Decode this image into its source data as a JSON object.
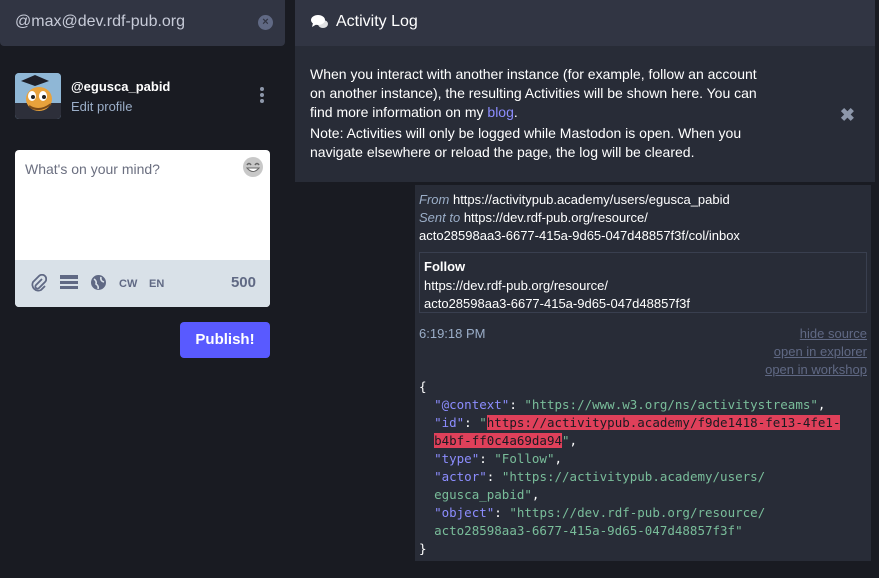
{
  "search": {
    "value": "@max@dev.rdf-pub.org"
  },
  "account": {
    "handle": "@egusca_pabid",
    "edit_label": "Edit profile"
  },
  "compose": {
    "placeholder": "What's on your mind?",
    "cw_label": "CW",
    "lang_label": "EN",
    "char_count": "500",
    "publish_label": "Publish!"
  },
  "column": {
    "title": "Activity Log",
    "notice_p1_before": "When you interact with another instance (for example, follow an account on another instance), the resulting Activities will be shown here. You can find more information on my ",
    "notice_link": "blog",
    "notice_p1_after": ".",
    "notice_p2": "Note: Activities will only be logged while Mastodon is open. When you navigate elsewhere or reload the page, the log will be cleared."
  },
  "entry": {
    "from_label": "From",
    "from_value": "https://activitypub.academy/users/egusca_pabid",
    "sent_label": "Sent to",
    "sent_value_1": "https://dev.rdf-pub.org/resource/",
    "sent_value_2": "acto28598aa3-6677-415a-9d65-047d48857f3f/col/inbox",
    "type_label": "Follow",
    "object_1": "https://dev.rdf-pub.org/resource/",
    "object_2": "acto28598aa3-6677-415a-9d65-047d48857f3f",
    "time": "6:19:18 PM",
    "hide_source": "hide source",
    "open_explorer": "open in explorer",
    "open_workshop": "open in workshop"
  },
  "json": {
    "context_key": "\"@context\"",
    "context_val": "\"https://www.w3.org/ns/activitystreams\"",
    "id_key": "\"id\"",
    "id_val_1": "https://activitypub.academy/f9de1418-fe13-4fe1-",
    "id_val_2": "b4bf-ff0c4a69da94",
    "type_key": "\"type\"",
    "type_val": "\"Follow\"",
    "actor_key": "\"actor\"",
    "actor_val_1": "\"https://activitypub.academy/users/",
    "actor_val_2": "egusca_pabid\"",
    "object_key": "\"object\"",
    "object_val_1": "\"https://dev.rdf-pub.org/resource/",
    "object_val_2": "acto28598aa3-6677-415a-9d65-047d48857f3f\""
  },
  "colors": {
    "accent": "#595aff",
    "link": "#8c8dff",
    "string": "#79bd9a",
    "highlight": "#df405a"
  },
  "icons": [
    "search-clear-icon",
    "kebab-menu-icon",
    "emoji-icon",
    "paperclip-icon",
    "poll-icon",
    "globe-icon",
    "comments-icon",
    "close-icon"
  ]
}
